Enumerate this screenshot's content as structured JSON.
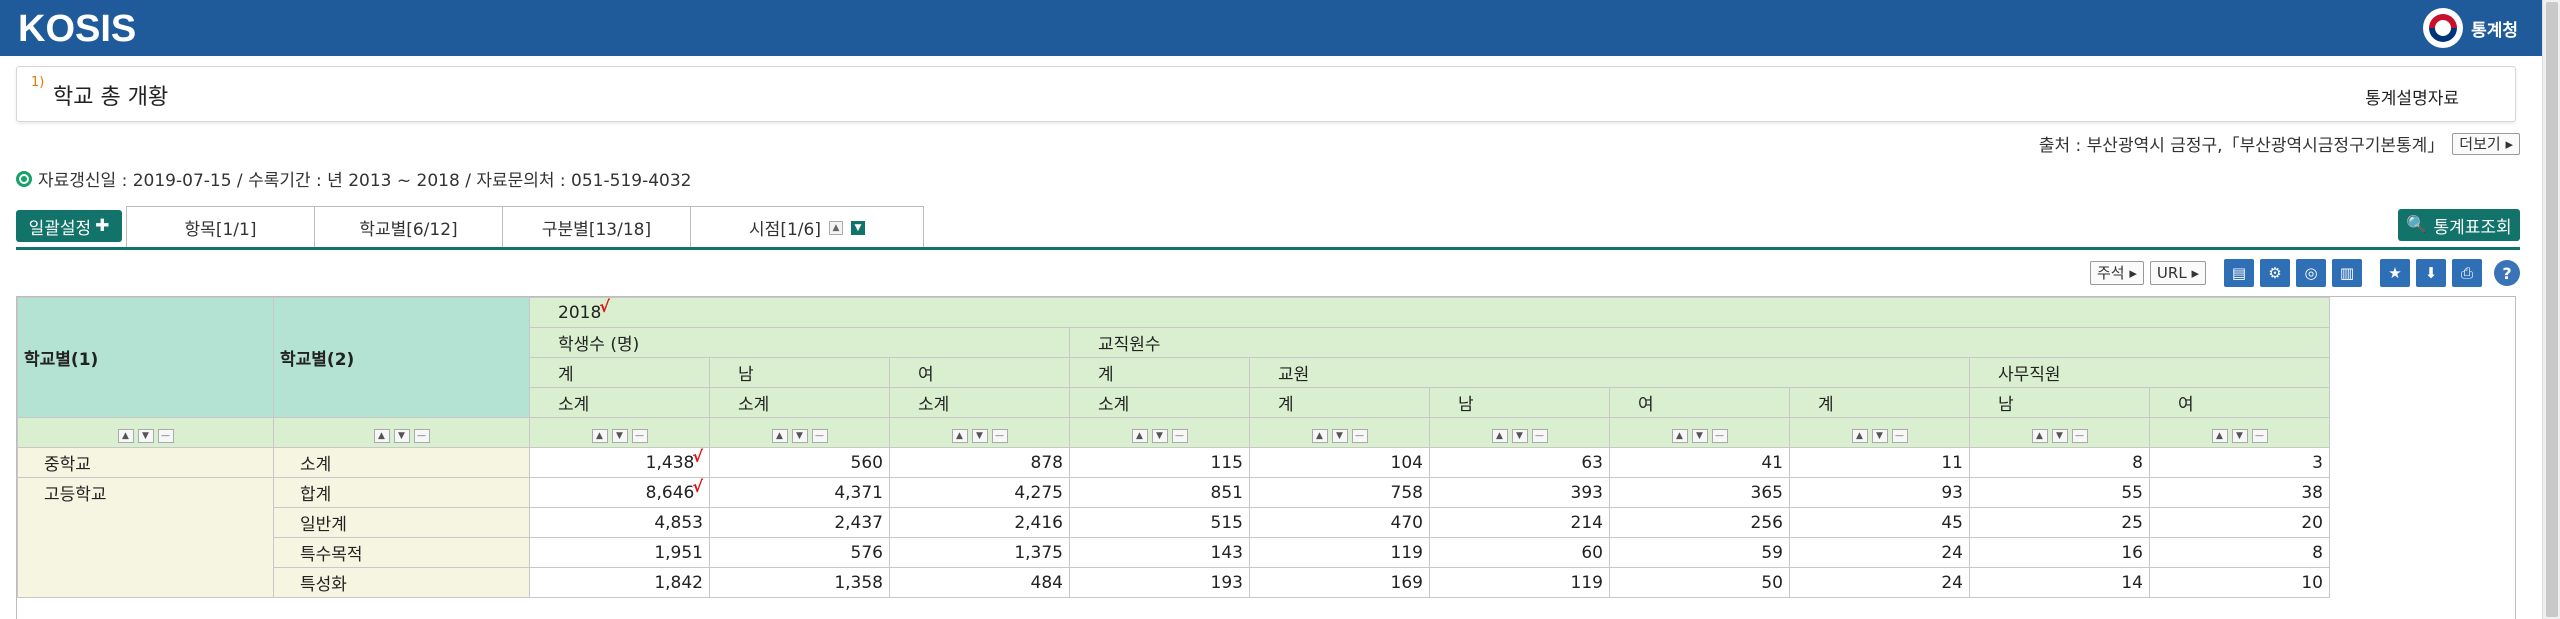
{
  "header": {
    "logo": "KOSIS",
    "org": "통계청",
    "org_icon": "government-emblem-icon"
  },
  "title_box": {
    "footnote": "1)",
    "title": "학교 총 개황",
    "desc_link": "통계설명자료"
  },
  "source": {
    "text": "출처 : 부산광역시 금정구,「부산광역시금정구기본통계」",
    "more": "더보기"
  },
  "info": {
    "text": "자료갱신일 : 2019-07-15 / 수록기간 : 년 2013 ~ 2018 / 자료문의처 : 051-519-4032"
  },
  "controls": {
    "batch": "일괄설정",
    "search": "통계표조회",
    "tabs": [
      "항목[1/1]",
      "학교별[6/12]",
      "구분별[13/18]",
      "시점[1/6]"
    ]
  },
  "toolbar": {
    "note": "주석",
    "url": "URL"
  },
  "table": {
    "dim1": "학교별(1)",
    "dim2": "학교별(2)",
    "year": "2018",
    "group1": "학생수 (명)",
    "group2": "교직원수",
    "sub_teacher": "교원",
    "sub_staff": "사무직원",
    "lvl3": [
      "계",
      "남",
      "여",
      "계",
      "계",
      "남",
      "여",
      "계",
      "남",
      "여"
    ],
    "lvl4": [
      "소계",
      "소계",
      "소계",
      "소계"
    ],
    "rows": [
      {
        "d1": "중학교",
        "d2": "소계",
        "v": [
          "1,438",
          "560",
          "878",
          "115",
          "104",
          "63",
          "41",
          "11",
          "8",
          "3"
        ]
      },
      {
        "d1": "고등학교",
        "d2": "합계",
        "v": [
          "8,646",
          "4,371",
          "4,275",
          "851",
          "758",
          "393",
          "365",
          "93",
          "55",
          "38"
        ]
      },
      {
        "d1": "",
        "d2": "일반계",
        "v": [
          "4,853",
          "2,437",
          "2,416",
          "515",
          "470",
          "214",
          "256",
          "45",
          "25",
          "20"
        ]
      },
      {
        "d1": "",
        "d2": "특수목적",
        "v": [
          "1,951",
          "576",
          "1,375",
          "143",
          "119",
          "60",
          "59",
          "24",
          "16",
          "8"
        ]
      },
      {
        "d1": "",
        "d2": "특성화",
        "v": [
          "1,842",
          "1,358",
          "484",
          "193",
          "169",
          "119",
          "50",
          "24",
          "14",
          "10"
        ]
      }
    ]
  }
}
